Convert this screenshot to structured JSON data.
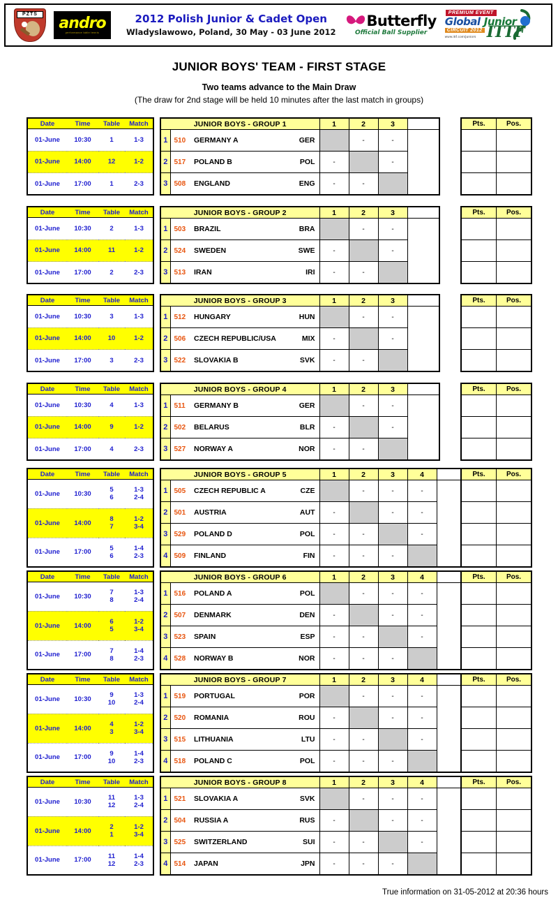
{
  "banner": {
    "federation_logo": "pzts-crest-icon",
    "federation_text": "PZTS",
    "sponsor_logo": "andro-logo-icon",
    "sponsor_name": "andro",
    "sponsor_tagline": "performance table tennis",
    "event_title": "2012 Polish Junior & Cadet Open",
    "event_location": "Wladyslawowo, Poland, 30 May - 03 June 2012",
    "ball_supplier_logo": "butterfly-logo-icon",
    "ball_supplier_name": "Butterfly",
    "ball_supplier_tagline": "Official Ball Supplier",
    "circuit_premium": "PREMIUM EVENT",
    "circuit_global": "Global",
    "circuit_junior": "Junior",
    "circuit_label": "CIRCUIT 2012",
    "circuit_url": "www.ittf.com/juniors",
    "circuit_ittf": "ITTF"
  },
  "page": {
    "title": "JUNIOR BOYS' TEAM - FIRST STAGE",
    "subtitle_1": "Two teams advance to the Main Draw",
    "subtitle_2": "(The draw for 2nd stage will be held 10 minutes after the last match in groups)",
    "footer": "True information on 31-05-2012 at 20:36 hours"
  },
  "schedule_headers": [
    "Date",
    "Time",
    "Table",
    "Match"
  ],
  "standings_headers": {
    "pts": "Pts.",
    "pos": "Pos."
  },
  "empty_cell": "-",
  "colors": {
    "header_yellow": "#FFFF00",
    "group_header_yellow": "#FFFF99",
    "diagonal_gray": "#CCCCCC",
    "id_orange": "#E8540E",
    "text_blue": "#2020CC"
  },
  "groups": [
    {
      "name": "JUNIOR BOYS - GROUP 1",
      "size": 3,
      "columns": [
        "1",
        "2",
        "3"
      ],
      "schedule": [
        {
          "date": "01-June",
          "time": "10:30",
          "tables": [
            "1"
          ],
          "matches": [
            "1-3"
          ],
          "highlight": false
        },
        {
          "date": "01-June",
          "time": "14:00",
          "tables": [
            "12"
          ],
          "matches": [
            "1-2"
          ],
          "highlight": true
        },
        {
          "date": "01-June",
          "time": "17:00",
          "tables": [
            "1"
          ],
          "matches": [
            "2-3"
          ],
          "highlight": false
        }
      ],
      "teams": [
        {
          "rank": "1",
          "id": "510",
          "name": "GERMANY A",
          "code": "GER"
        },
        {
          "rank": "2",
          "id": "517",
          "name": "POLAND B",
          "code": "POL"
        },
        {
          "rank": "3",
          "id": "508",
          "name": "ENGLAND",
          "code": "ENG"
        }
      ]
    },
    {
      "name": "JUNIOR BOYS - GROUP 2",
      "size": 3,
      "columns": [
        "1",
        "2",
        "3"
      ],
      "schedule": [
        {
          "date": "01-June",
          "time": "10:30",
          "tables": [
            "2"
          ],
          "matches": [
            "1-3"
          ],
          "highlight": false
        },
        {
          "date": "01-June",
          "time": "14:00",
          "tables": [
            "11"
          ],
          "matches": [
            "1-2"
          ],
          "highlight": true
        },
        {
          "date": "01-June",
          "time": "17:00",
          "tables": [
            "2"
          ],
          "matches": [
            "2-3"
          ],
          "highlight": false
        }
      ],
      "teams": [
        {
          "rank": "1",
          "id": "503",
          "name": "BRAZIL",
          "code": "BRA"
        },
        {
          "rank": "2",
          "id": "524",
          "name": "SWEDEN",
          "code": "SWE"
        },
        {
          "rank": "3",
          "id": "513",
          "name": "IRAN",
          "code": "IRI"
        }
      ]
    },
    {
      "name": "JUNIOR BOYS - GROUP 3",
      "size": 3,
      "columns": [
        "1",
        "2",
        "3"
      ],
      "schedule": [
        {
          "date": "01-June",
          "time": "10:30",
          "tables": [
            "3"
          ],
          "matches": [
            "1-3"
          ],
          "highlight": false
        },
        {
          "date": "01-June",
          "time": "14:00",
          "tables": [
            "10"
          ],
          "matches": [
            "1-2"
          ],
          "highlight": true
        },
        {
          "date": "01-June",
          "time": "17:00",
          "tables": [
            "3"
          ],
          "matches": [
            "2-3"
          ],
          "highlight": false
        }
      ],
      "teams": [
        {
          "rank": "1",
          "id": "512",
          "name": "HUNGARY",
          "code": "HUN"
        },
        {
          "rank": "2",
          "id": "506",
          "name": "CZECH REPUBLIC/USA",
          "code": "MIX"
        },
        {
          "rank": "3",
          "id": "522",
          "name": "SLOVAKIA B",
          "code": "SVK"
        }
      ]
    },
    {
      "name": "JUNIOR BOYS - GROUP 4",
      "size": 3,
      "columns": [
        "1",
        "2",
        "3"
      ],
      "schedule": [
        {
          "date": "01-June",
          "time": "10:30",
          "tables": [
            "4"
          ],
          "matches": [
            "1-3"
          ],
          "highlight": false
        },
        {
          "date": "01-June",
          "time": "14:00",
          "tables": [
            "9"
          ],
          "matches": [
            "1-2"
          ],
          "highlight": true
        },
        {
          "date": "01-June",
          "time": "17:00",
          "tables": [
            "4"
          ],
          "matches": [
            "2-3"
          ],
          "highlight": false
        }
      ],
      "teams": [
        {
          "rank": "1",
          "id": "511",
          "name": "GERMANY B",
          "code": "GER"
        },
        {
          "rank": "2",
          "id": "502",
          "name": "BELARUS",
          "code": "BLR"
        },
        {
          "rank": "3",
          "id": "527",
          "name": "NORWAY A",
          "code": "NOR"
        }
      ]
    },
    {
      "name": "JUNIOR BOYS - GROUP 5",
      "size": 4,
      "columns": [
        "1",
        "2",
        "3",
        "4"
      ],
      "schedule": [
        {
          "date": "01-June",
          "time": "10:30",
          "tables": [
            "5",
            "6"
          ],
          "matches": [
            "1-3",
            "2-4"
          ],
          "highlight": false
        },
        {
          "date": "01-June",
          "time": "14:00",
          "tables": [
            "8",
            "7"
          ],
          "matches": [
            "1-2",
            "3-4"
          ],
          "highlight": true
        },
        {
          "date": "01-June",
          "time": "17:00",
          "tables": [
            "5",
            "6"
          ],
          "matches": [
            "1-4",
            "2-3"
          ],
          "highlight": false
        }
      ],
      "teams": [
        {
          "rank": "1",
          "id": "505",
          "name": "CZECH REPUBLIC A",
          "code": "CZE"
        },
        {
          "rank": "2",
          "id": "501",
          "name": "AUSTRIA",
          "code": "AUT"
        },
        {
          "rank": "3",
          "id": "529",
          "name": "POLAND D",
          "code": "POL"
        },
        {
          "rank": "4",
          "id": "509",
          "name": "FINLAND",
          "code": "FIN"
        }
      ]
    },
    {
      "name": "JUNIOR BOYS - GROUP 6",
      "size": 4,
      "columns": [
        "1",
        "2",
        "3",
        "4"
      ],
      "schedule": [
        {
          "date": "01-June",
          "time": "10:30",
          "tables": [
            "7",
            "8"
          ],
          "matches": [
            "1-3",
            "2-4"
          ],
          "highlight": false
        },
        {
          "date": "01-June",
          "time": "14:00",
          "tables": [
            "6",
            "5"
          ],
          "matches": [
            "1-2",
            "3-4"
          ],
          "highlight": true
        },
        {
          "date": "01-June",
          "time": "17:00",
          "tables": [
            "7",
            "8"
          ],
          "matches": [
            "1-4",
            "2-3"
          ],
          "highlight": false
        }
      ],
      "teams": [
        {
          "rank": "1",
          "id": "516",
          "name": "POLAND A",
          "code": "POL"
        },
        {
          "rank": "2",
          "id": "507",
          "name": "DENMARK",
          "code": "DEN"
        },
        {
          "rank": "3",
          "id": "523",
          "name": "SPAIN",
          "code": "ESP"
        },
        {
          "rank": "4",
          "id": "528",
          "name": "NORWAY B",
          "code": "NOR"
        }
      ]
    },
    {
      "name": "JUNIOR BOYS - GROUP 7",
      "size": 4,
      "columns": [
        "1",
        "2",
        "3",
        "4"
      ],
      "schedule": [
        {
          "date": "01-June",
          "time": "10:30",
          "tables": [
            "9",
            "10"
          ],
          "matches": [
            "1-3",
            "2-4"
          ],
          "highlight": false
        },
        {
          "date": "01-June",
          "time": "14:00",
          "tables": [
            "4",
            "3"
          ],
          "matches": [
            "1-2",
            "3-4"
          ],
          "highlight": true
        },
        {
          "date": "01-June",
          "time": "17:00",
          "tables": [
            "9",
            "10"
          ],
          "matches": [
            "1-4",
            "2-3"
          ],
          "highlight": false
        }
      ],
      "teams": [
        {
          "rank": "1",
          "id": "519",
          "name": "PORTUGAL",
          "code": "POR"
        },
        {
          "rank": "2",
          "id": "520",
          "name": "ROMANIA",
          "code": "ROU"
        },
        {
          "rank": "3",
          "id": "515",
          "name": "LITHUANIA",
          "code": "LTU"
        },
        {
          "rank": "4",
          "id": "518",
          "name": "POLAND C",
          "code": "POL"
        }
      ]
    },
    {
      "name": "JUNIOR BOYS - GROUP 8",
      "size": 4,
      "columns": [
        "1",
        "2",
        "3",
        "4"
      ],
      "schedule": [
        {
          "date": "01-June",
          "time": "10:30",
          "tables": [
            "11",
            "12"
          ],
          "matches": [
            "1-3",
            "2-4"
          ],
          "highlight": false
        },
        {
          "date": "01-June",
          "time": "14:00",
          "tables": [
            "2",
            "1"
          ],
          "matches": [
            "1-2",
            "3-4"
          ],
          "highlight": true
        },
        {
          "date": "01-June",
          "time": "17:00",
          "tables": [
            "11",
            "12"
          ],
          "matches": [
            "1-4",
            "2-3"
          ],
          "highlight": false
        }
      ],
      "teams": [
        {
          "rank": "1",
          "id": "521",
          "name": "SLOVAKIA A",
          "code": "SVK"
        },
        {
          "rank": "2",
          "id": "504",
          "name": "RUSSIA A",
          "code": "RUS"
        },
        {
          "rank": "3",
          "id": "525",
          "name": "SWITZERLAND",
          "code": "SUI"
        },
        {
          "rank": "4",
          "id": "514",
          "name": "JAPAN",
          "code": "JPN"
        }
      ]
    }
  ]
}
